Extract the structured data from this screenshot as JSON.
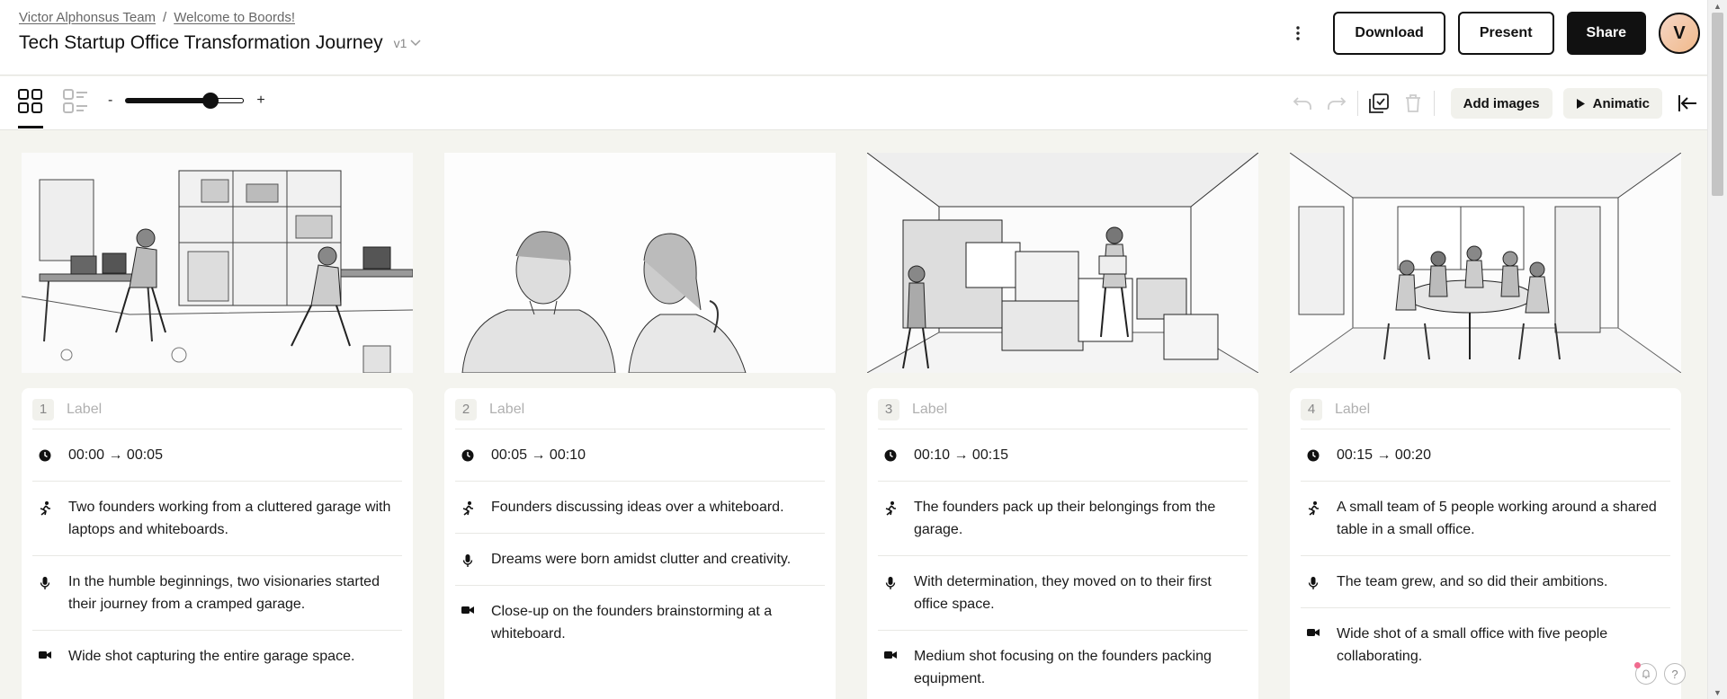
{
  "header": {
    "breadcrumb": [
      "Victor Alphonsus Team",
      "Welcome to Boords!"
    ],
    "breadcrumb_sep": "/",
    "title": "Tech Startup Office Transformation Journey",
    "version": "v1",
    "buttons": {
      "download": "Download",
      "present": "Present",
      "share": "Share"
    },
    "avatar_initial": "V"
  },
  "toolbar": {
    "zoom_minus": "-",
    "zoom_plus": "+",
    "zoom_level": 0.72,
    "add_images": "Add images",
    "animatic": "Animatic"
  },
  "frames": [
    {
      "number": "1",
      "label_placeholder": "Label",
      "time": "00:00 → 00:05",
      "action": "Two founders working from a cluttered garage with laptops and whiteboards.",
      "voiceover": "In the humble beginnings, two visionaries started their journey from a cramped garage.",
      "camera": "Wide shot capturing the entire garage space."
    },
    {
      "number": "2",
      "label_placeholder": "Label",
      "time": "00:05 → 00:10",
      "action": "Founders discussing ideas over a whiteboard.",
      "voiceover": "Dreams were born amidst clutter and creativity.",
      "camera": "Close-up on the founders brainstorming at a whiteboard."
    },
    {
      "number": "3",
      "label_placeholder": "Label",
      "time": "00:10 → 00:15",
      "action": "The founders pack up their belongings from the garage.",
      "voiceover": "With determination, they moved on to their first office space.",
      "camera": "Medium shot focusing on the founders packing equipment."
    },
    {
      "number": "4",
      "label_placeholder": "Label",
      "time": "00:15 → 00:20",
      "action": "A small team of 5 people working around a shared table in a small office.",
      "voiceover": "The team grew, and so did their ambitions.",
      "camera": "Wide shot of a small office with five people collaborating."
    }
  ],
  "help": {
    "question": "?"
  }
}
